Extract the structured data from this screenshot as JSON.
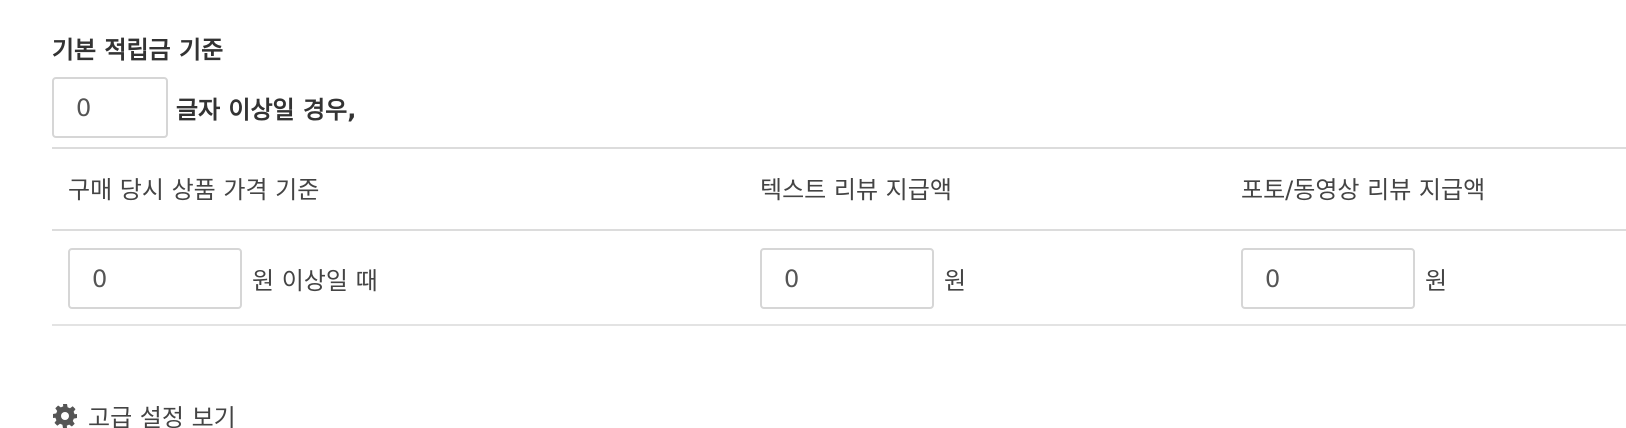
{
  "section": {
    "title": "기본 적립금 기준"
  },
  "min_length": {
    "value": "0",
    "suffix": "글자 이상일 경우,"
  },
  "table": {
    "headers": [
      "구매 당시 상품 가격 기준",
      "텍스트 리뷰 지급액",
      "포토/동영상 리뷰 지급액"
    ],
    "row": {
      "price_threshold": {
        "value": "0",
        "unit": "원 이상일 때"
      },
      "text_review_amount": {
        "value": "0",
        "unit": "원"
      },
      "photo_review_amount": {
        "value": "0",
        "unit": "원"
      }
    }
  },
  "advanced": {
    "label": "고급 설정 보기",
    "icon": "gear-icon"
  },
  "colors": {
    "text": "#333333",
    "border": "#d6d6d6",
    "divider": "#dcdcdc"
  }
}
